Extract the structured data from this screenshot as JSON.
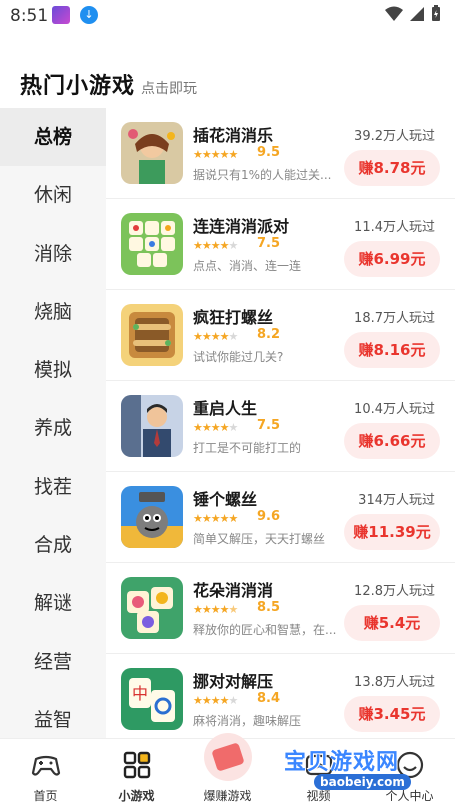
{
  "status_bar": {
    "time": "8:51"
  },
  "header": {
    "title": "热门小游戏",
    "subtitle": "点击即玩"
  },
  "categories": [
    {
      "label": "总榜",
      "active": true
    },
    {
      "label": "休闲",
      "active": false
    },
    {
      "label": "消除",
      "active": false
    },
    {
      "label": "烧脑",
      "active": false
    },
    {
      "label": "模拟",
      "active": false
    },
    {
      "label": "养成",
      "active": false
    },
    {
      "label": "找茬",
      "active": false
    },
    {
      "label": "合成",
      "active": false
    },
    {
      "label": "解谜",
      "active": false
    },
    {
      "label": "经营",
      "active": false
    },
    {
      "label": "益智",
      "active": false
    }
  ],
  "games": [
    {
      "name": "插花消消乐",
      "rating": 4.75,
      "score": "9.5",
      "desc": "据说只有1%的人能过关...",
      "plays": "39.2万人玩过",
      "reward": "赚8.78元",
      "icon": "flower-girl-icon",
      "color": "#3d9b5c"
    },
    {
      "name": "连连消消派对",
      "rating": 3.75,
      "score": "7.5",
      "desc": "点点、消消、连一连",
      "plays": "11.4万人玩过",
      "reward": "赚6.99元",
      "icon": "tile-match-icon",
      "color": "#66b847"
    },
    {
      "name": "疯狂打螺丝",
      "rating": 4.1,
      "score": "8.2",
      "desc": "试试你能过几关?",
      "plays": "18.7万人玩过",
      "reward": "赚8.16元",
      "icon": "screw-board-icon",
      "color": "#e0a24a"
    },
    {
      "name": "重启人生",
      "rating": 3.75,
      "score": "7.5",
      "desc": "打工是不可能打工的",
      "plays": "10.4万人玩过",
      "reward": "赚6.66元",
      "icon": "office-man-icon",
      "color": "#4a6fa5"
    },
    {
      "name": "锤个螺丝",
      "rating": 4.8,
      "score": "9.6",
      "desc": "简单又解压，天天打螺丝",
      "plays": "314万人玩过",
      "reward": "赚11.39元",
      "icon": "hammer-screw-icon",
      "color": "#2f7fd1"
    },
    {
      "name": "花朵消消消",
      "rating": 4.25,
      "score": "8.5",
      "desc": "释放你的匠心和智慧，在...",
      "plays": "12.8万人玩过",
      "reward": "赚5.4元",
      "icon": "flower-tile-icon",
      "color": "#3fa36a"
    },
    {
      "name": "挪对对解压",
      "rating": 4.2,
      "score": "8.4",
      "desc": "麻将消消，趣味解压",
      "plays": "13.8万人玩过",
      "reward": "赚3.45元",
      "icon": "mahjong-tile-icon",
      "color": "#2e9a63"
    }
  ],
  "tabbar": [
    {
      "label": "首页",
      "icon": "gamepad-icon"
    },
    {
      "label": "小游戏",
      "icon": "grid-icon"
    },
    {
      "label": "爆赚游戏",
      "icon": "cash-icon"
    },
    {
      "label": "视频",
      "icon": "video-icon"
    },
    {
      "label": "个人中心",
      "icon": "profile-icon"
    }
  ],
  "watermark": {
    "text": "宝贝游戏网",
    "url": "baobeiy.com"
  },
  "colors": {
    "accent_red": "#e9352e",
    "reward_bg": "#fdeceb",
    "star": "#f5a623",
    "sidebar_bg": "#f6f6f6"
  }
}
